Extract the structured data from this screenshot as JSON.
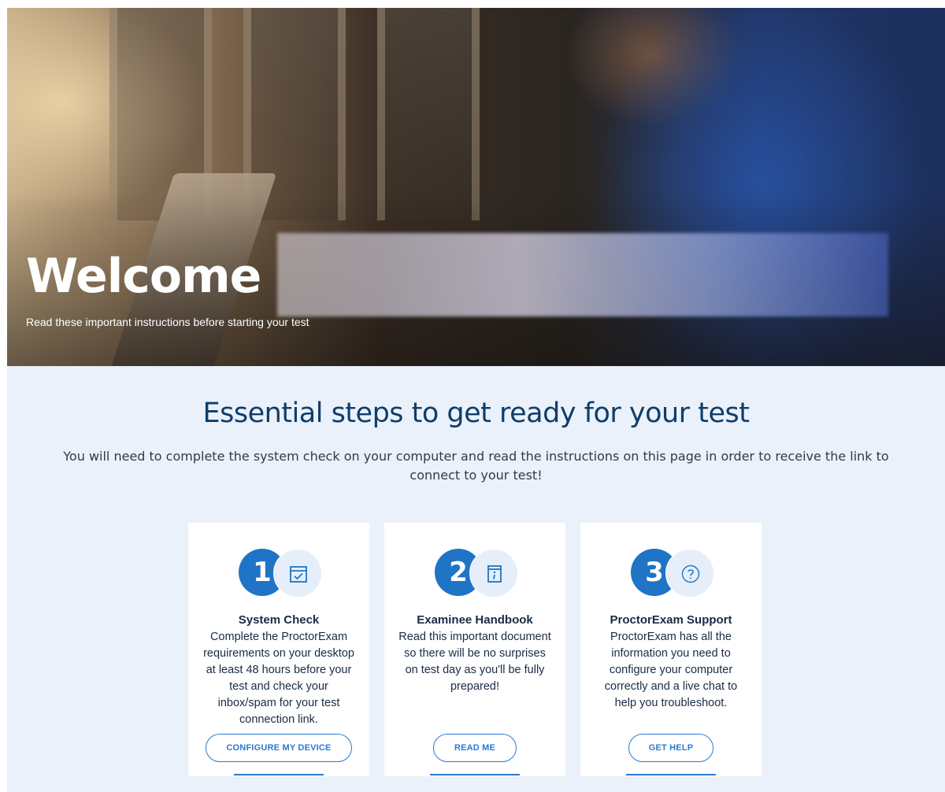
{
  "hero": {
    "title": "Welcome",
    "subtitle": "Read these important instructions before starting your test"
  },
  "main": {
    "headline": "Essential steps to get ready for your test",
    "intro": "You will need to complete the system check on your computer and read the instructions on this page in order to receive the link to connect to your test!"
  },
  "steps": [
    {
      "number": "1",
      "icon": "calendar-check-icon",
      "title": "System Check",
      "description": "Complete the ProctorExam requirements on your desktop at least 48 hours before your test and check your inbox/spam for your test connection link.",
      "button": "CONFIGURE MY DEVICE"
    },
    {
      "number": "2",
      "icon": "info-document-icon",
      "title": "Examinee Handbook",
      "description": "Read this important document so there will be no surprises on test day as you'll be fully prepared!",
      "button": "READ ME"
    },
    {
      "number": "3",
      "icon": "question-circle-icon",
      "title": "ProctorExam Support",
      "description": "ProctorExam has all the information you need to configure your computer correctly and a live chat to help you troubleshoot.",
      "button": "GET HELP"
    }
  ],
  "colors": {
    "accent": "#1f74c5",
    "heading": "#0f3d6b",
    "section_bg": "#eaf1fa"
  }
}
